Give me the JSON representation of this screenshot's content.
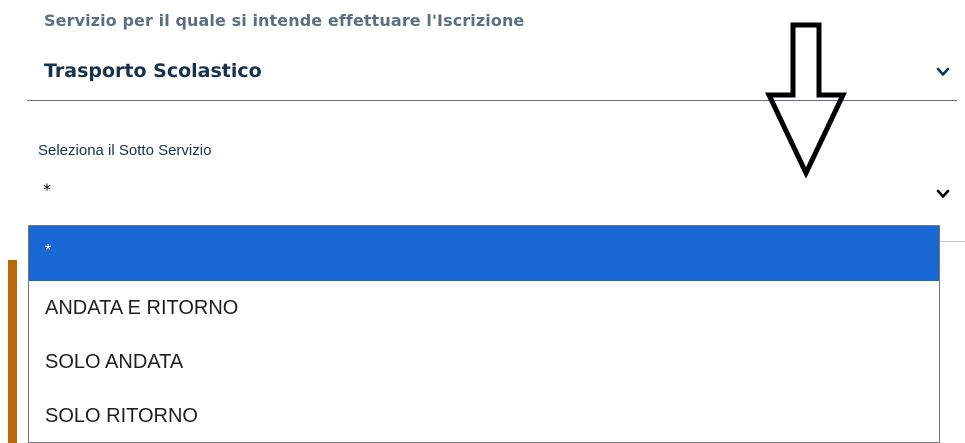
{
  "service": {
    "label": "Servizio per il quale si intende effettuare l'Iscrizione",
    "value": "Trasporto Scolastico"
  },
  "sub_service": {
    "label": "Seleziona il Sotto Servizio",
    "value": "*",
    "options": [
      {
        "label": "*",
        "selected": true
      },
      {
        "label": "ANDATA E RITORNO",
        "selected": false
      },
      {
        "label": "SOLO ANDATA",
        "selected": false
      },
      {
        "label": "SOLO RITORNO",
        "selected": false
      }
    ]
  },
  "colors": {
    "label_gray": "#5b6f82",
    "value_navy": "#17324d",
    "selected_blue": "#1967d2",
    "accent_bar": "#b8690a"
  },
  "icons": {
    "select_chevron": "chevron-down-icon",
    "annotation": "hollow-down-arrow-icon"
  }
}
